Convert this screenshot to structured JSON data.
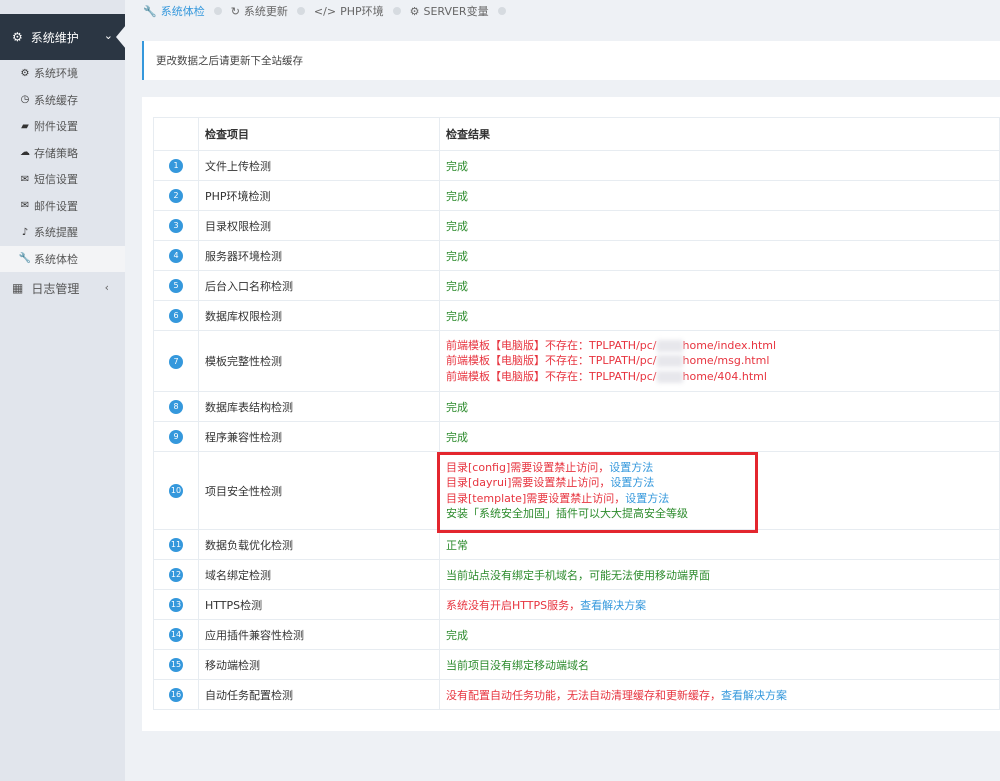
{
  "sidebar": {
    "parent": {
      "label": "系统维护",
      "icon": "gear-icon"
    },
    "items": [
      {
        "label": "系统环境",
        "icon": "gear-icon"
      },
      {
        "label": "系统缓存",
        "icon": "clock-icon"
      },
      {
        "label": "附件设置",
        "icon": "folder-icon"
      },
      {
        "label": "存储策略",
        "icon": "cloud-icon"
      },
      {
        "label": "短信设置",
        "icon": "envelope-icon"
      },
      {
        "label": "邮件设置",
        "icon": "envelope-open-icon"
      },
      {
        "label": "系统提醒",
        "icon": "bell-icon"
      },
      {
        "label": "系统体检",
        "icon": "wrench-icon"
      }
    ],
    "log": {
      "label": "日志管理",
      "icon": "calendar-icon"
    }
  },
  "tabs": [
    {
      "label": "系统体检",
      "icon": "wrench-icon"
    },
    {
      "label": "系统更新",
      "icon": "refresh-icon"
    },
    {
      "label": "PHP环境",
      "icon": "code-icon"
    },
    {
      "label": "SERVER变量",
      "icon": "gear-icon"
    }
  ],
  "note": "更改数据之后请更新下全站缓存",
  "table": {
    "headers": {
      "name": "检查项目",
      "result": "检查结果"
    },
    "rows": [
      {
        "num": "1",
        "name": "文件上传检测",
        "result": "完成"
      },
      {
        "num": "2",
        "name": "PHP环境检测",
        "result": "完成"
      },
      {
        "num": "3",
        "name": "目录权限检测",
        "result": "完成"
      },
      {
        "num": "4",
        "name": "服务器环境检测",
        "result": "完成"
      },
      {
        "num": "5",
        "name": "后台入口名称检测",
        "result": "完成"
      },
      {
        "num": "6",
        "name": "数据库权限检测",
        "result": "完成"
      },
      {
        "num": "7",
        "name": "模板完整性检测",
        "lines": [
          {
            "pre": "前端模板【电脑版】不存在：TPLPATH/pc/",
            "post": "home/index.html"
          },
          {
            "pre": "前端模板【电脑版】不存在：TPLPATH/pc/",
            "post": "home/msg.html"
          },
          {
            "pre": "前端模板【电脑版】不存在：TPLPATH/pc/",
            "post": "home/404.html"
          }
        ]
      },
      {
        "num": "8",
        "name": "数据库表结构检测",
        "result": "完成"
      },
      {
        "num": "9",
        "name": "程序兼容性检测",
        "result": "完成"
      },
      {
        "num": "10",
        "name": "项目安全性检测",
        "lines": [
          {
            "text": "目录[config]需要设置禁止访问，",
            "link": "设置方法"
          },
          {
            "text": "目录[dayrui]需要设置禁止访问，",
            "link": "设置方法"
          },
          {
            "text": "目录[template]需要设置禁止访问，",
            "link": "设置方法"
          },
          {
            "text": "安装「系统安全加固」插件可以大大提高安全等级"
          }
        ]
      },
      {
        "num": "11",
        "name": "数据负载优化检测",
        "result": "正常"
      },
      {
        "num": "12",
        "name": "域名绑定检测",
        "result": "当前站点没有绑定手机域名，可能无法使用移动端界面"
      },
      {
        "num": "13",
        "name": "HTTPS检测",
        "result": "系统没有开启HTTPS服务，",
        "link": "查看解决方案"
      },
      {
        "num": "14",
        "name": "应用插件兼容性检测",
        "result": "完成"
      },
      {
        "num": "15",
        "name": "移动端检测",
        "result": "当前项目没有绑定移动端域名"
      },
      {
        "num": "16",
        "name": "自动任务配置检测",
        "result": "没有配置自动任务功能，无法自动清理缓存和更新缓存，",
        "link": "查看解决方案"
      }
    ]
  },
  "colors": {
    "accent": "#3598dc",
    "success": "#2c8b2c",
    "error": "#e7343f",
    "highlight": "#e3262e",
    "sidebar_dark": "#2b3643"
  }
}
